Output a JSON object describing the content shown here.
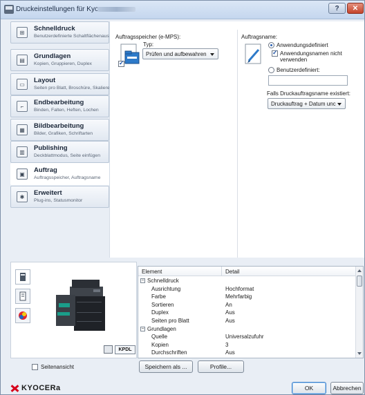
{
  "window": {
    "title": "Druckeinstellungen für Kyocera",
    "help_label": "?",
    "close_label": "✕"
  },
  "nav": {
    "items": [
      {
        "title": "Schnelldruck",
        "subtitle": "Benutzerdefinierte Schaltflächenauswahl"
      },
      {
        "title": "Grundlagen",
        "subtitle": "Kopien, Gruppieren, Duplex"
      },
      {
        "title": "Layout",
        "subtitle": "Seiten pro Blatt, Broschüre, Skalieren"
      },
      {
        "title": "Endbearbeitung",
        "subtitle": "Binden, Falten, Heften, Lochen"
      },
      {
        "title": "Bildbearbeitung",
        "subtitle": "Bilder, Grafiken, Schriftarten"
      },
      {
        "title": "Publishing",
        "subtitle": "Deckblattmodus, Seite einfügen"
      },
      {
        "title": "Auftrag",
        "subtitle": "Auftragsspeicher, Auftragsname"
      },
      {
        "title": "Erweitert",
        "subtitle": "Plug-ins, Statusmonitor"
      }
    ],
    "active_index": 6
  },
  "job_storage": {
    "section_label": "Auftragsspeicher (e-MPS):",
    "type_label": "Typ:",
    "type_value": "Prüfen und aufbewahren",
    "storage_enabled": true
  },
  "job_name": {
    "section_label": "Auftragsname:",
    "option_app_defined": "Anwendungsdefiniert",
    "option_app_defined_selected": true,
    "checkbox_no_app_name_line1": "Anwendungsnamen nicht",
    "checkbox_no_app_name_line2": "verwenden",
    "checkbox_no_app_name_checked": true,
    "option_user_defined": "Benutzerdefiniert:",
    "user_defined_value": "",
    "exists_label": "Falls Druckauftragsname existiert:",
    "exists_value": "Druckauftrag + Datum unc"
  },
  "preview": {
    "kpdl_label": "KPDL",
    "page_view_label": "Seitenansicht",
    "page_view_checked": false
  },
  "summary": {
    "col_element": "Element",
    "col_detail": "Detail",
    "rows": [
      {
        "type": "group",
        "element": "Schnelldruck",
        "detail": ""
      },
      {
        "type": "item",
        "element": "Ausrichtung",
        "detail": "Hochformat"
      },
      {
        "type": "item",
        "element": "Farbe",
        "detail": "Mehrfarbig"
      },
      {
        "type": "item",
        "element": "Sortieren",
        "detail": "An"
      },
      {
        "type": "item",
        "element": "Duplex",
        "detail": "Aus"
      },
      {
        "type": "item",
        "element": "Seiten pro Blatt",
        "detail": "Aus"
      },
      {
        "type": "group",
        "element": "Grundlagen",
        "detail": ""
      },
      {
        "type": "item",
        "element": "Quelle",
        "detail": "Universalzufuhr"
      },
      {
        "type": "item",
        "element": "Kopien",
        "detail": "3"
      },
      {
        "type": "item",
        "element": "Durchschriften",
        "detail": "Aus"
      }
    ]
  },
  "buttons": {
    "save_as": "Speichern als ...",
    "profiles": "Profile...",
    "ok": "OK",
    "cancel": "Abbrechen"
  },
  "brand": {
    "logo_text": "KYOCERa",
    "accent": "#d6001c"
  }
}
